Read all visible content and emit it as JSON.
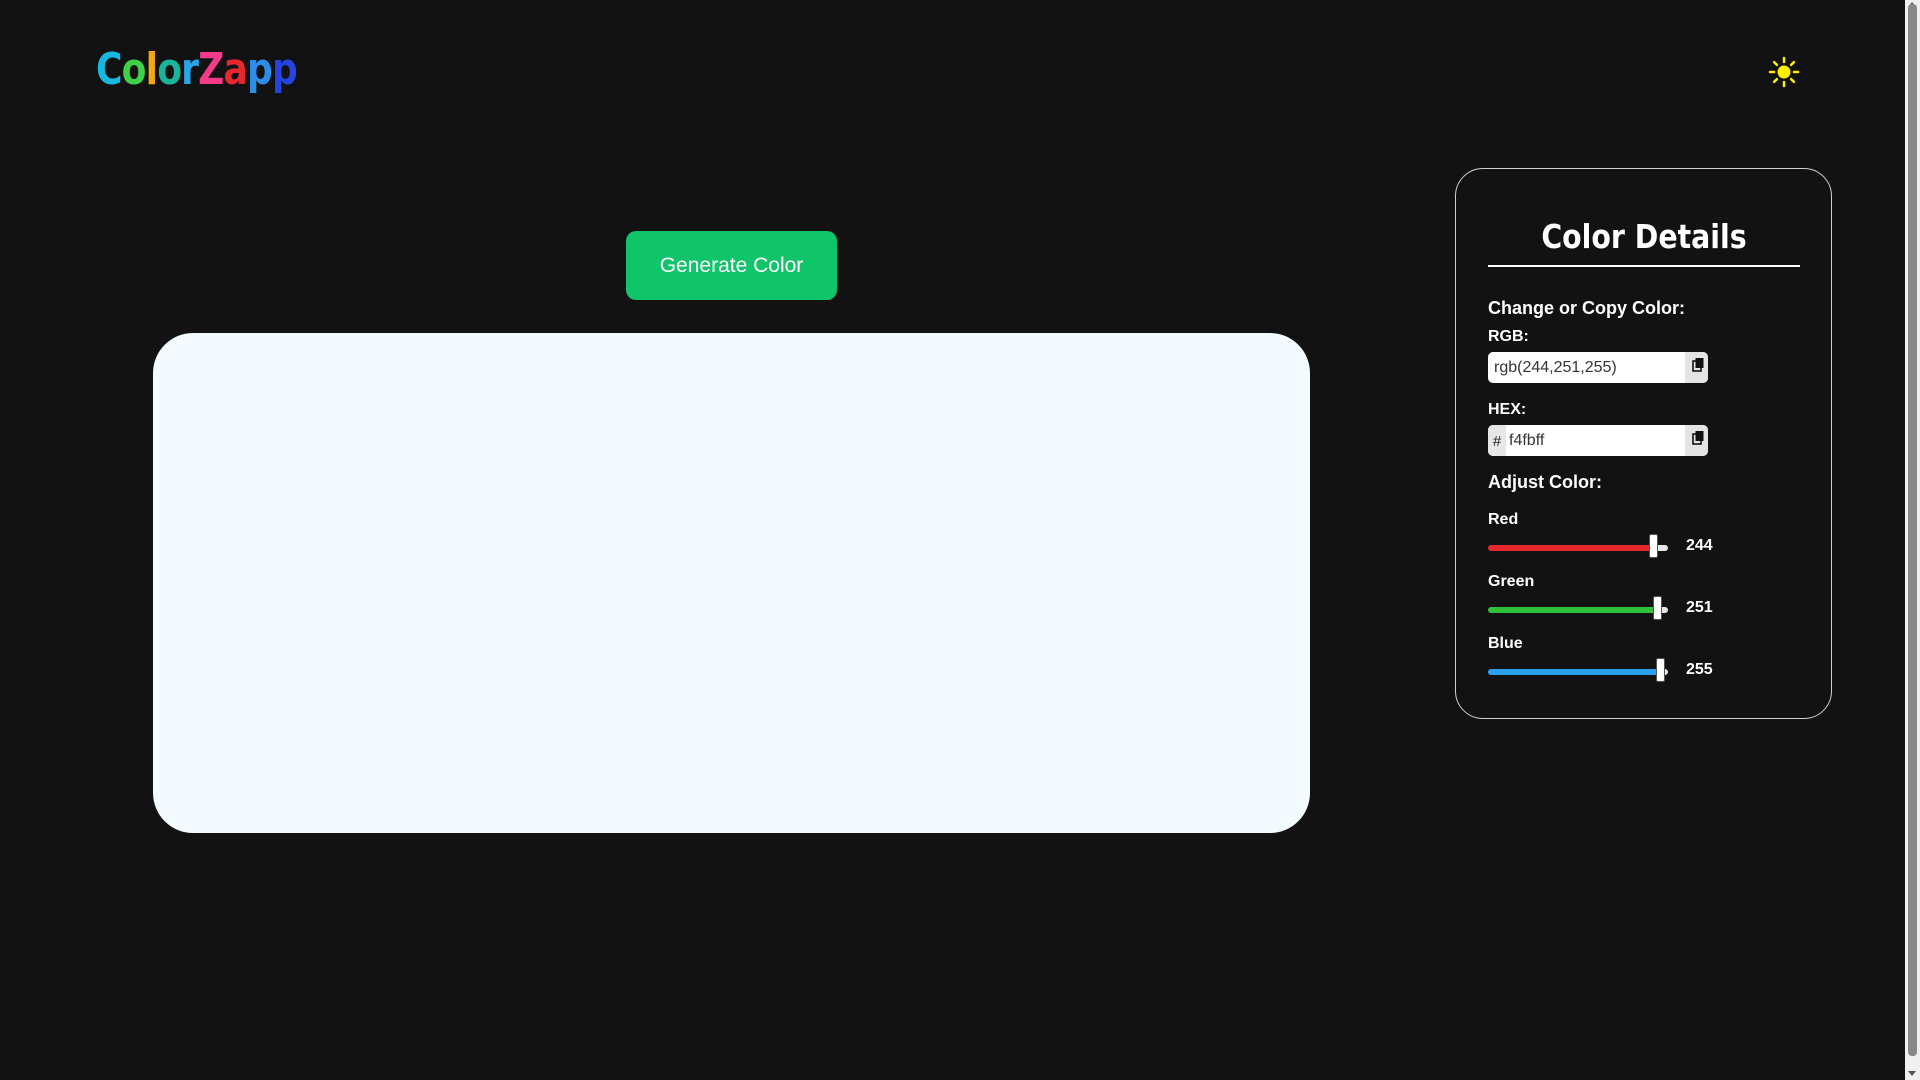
{
  "header": {
    "logo_letters": [
      {
        "char": "C",
        "color": "#17b8e0"
      },
      {
        "char": "o",
        "color": "#3fd04a"
      },
      {
        "char": "l",
        "color": "#f2a716"
      },
      {
        "char": "o",
        "color": "#19b59a"
      },
      {
        "char": "r",
        "color": "#2aa5e8"
      },
      {
        "char": "Z",
        "color": "#f43b8a"
      },
      {
        "char": "a",
        "color": "#e8262e"
      },
      {
        "char": "p",
        "color": "#2b8fe8"
      },
      {
        "char": "p",
        "color": "#2443e0"
      }
    ],
    "theme_icon": "sun-icon",
    "theme_icon_color": "#ffee00"
  },
  "main": {
    "generate_label": "Generate Color",
    "generate_color": "#10c46a",
    "preview_color": "#f4fbff"
  },
  "panel": {
    "title": "Color Details",
    "copy_section_label": "Change or Copy Color:",
    "rgb_label": "RGB:",
    "rgb_value": "rgb(244,251,255)",
    "hex_label": "HEX:",
    "hex_prefix": "#",
    "hex_value": "f4fbff",
    "copy_icon": "copy-icon",
    "adjust_section_label": "Adjust Color:",
    "sliders": [
      {
        "label": "Red",
        "value": 244,
        "max": 255,
        "color": "#e8262e"
      },
      {
        "label": "Green",
        "value": 251,
        "max": 255,
        "color": "#2ec23a"
      },
      {
        "label": "Blue",
        "value": 255,
        "max": 255,
        "color": "#2a9ff0"
      }
    ]
  }
}
